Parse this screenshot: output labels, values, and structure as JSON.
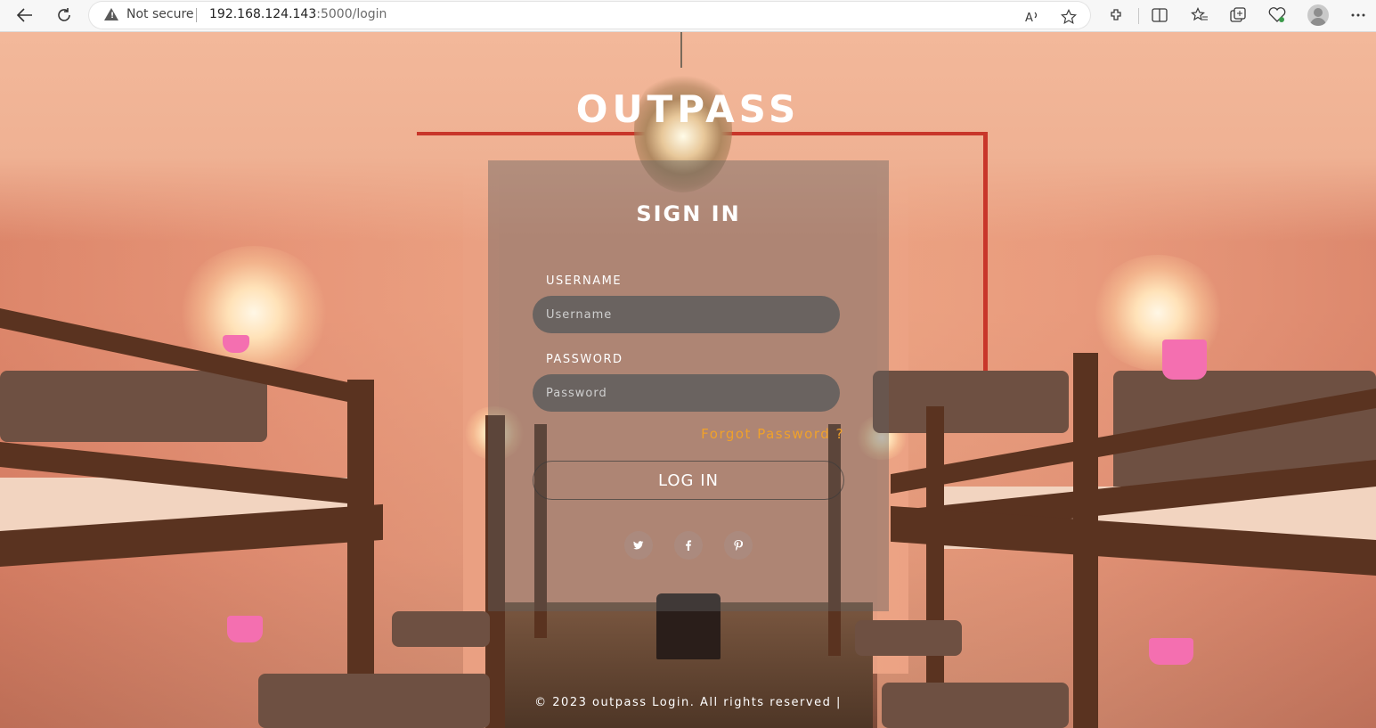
{
  "browser": {
    "security_label": "Not secure",
    "url_host": "192.168.124.143",
    "url_path": ":5000/login",
    "icons": [
      "back-icon",
      "refresh-icon",
      "read-aloud-icon",
      "favorite-icon",
      "extensions-icon",
      "split-screen-icon",
      "favorites-icon",
      "collections-icon",
      "browser-essentials-icon",
      "profile-avatar",
      "more-icon"
    ]
  },
  "page": {
    "brand": "OUTPASS",
    "title": "SIGN IN",
    "username_label": "USERNAME",
    "username_placeholder": "Username",
    "password_label": "PASSWORD",
    "password_placeholder": "Password",
    "forgot_label": "Forgot Password ?",
    "login_label": "LOG IN",
    "social": [
      {
        "name": "twitter",
        "glyph": "🐦"
      },
      {
        "name": "facebook",
        "glyph": "f"
      },
      {
        "name": "pinterest",
        "glyph": "p"
      }
    ],
    "footer": "© 2023 outpass Login. All rights reserved |",
    "accent_color": "#f0a12a"
  }
}
